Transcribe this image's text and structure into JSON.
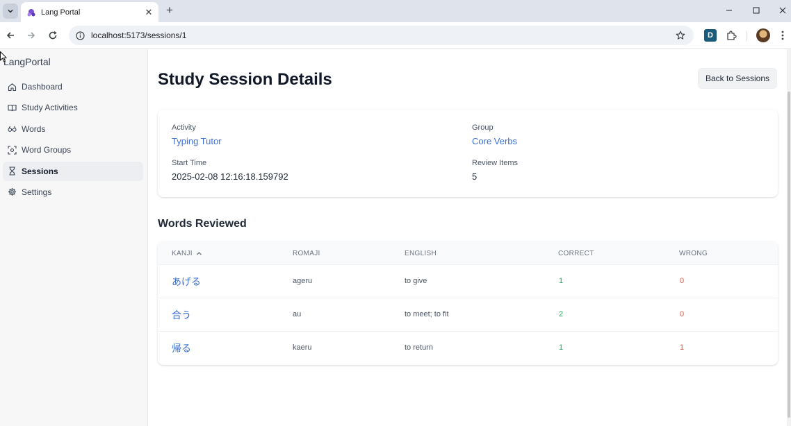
{
  "browser": {
    "tab_title": "Lang Portal",
    "url": "localhost:5173/sessions/1"
  },
  "sidebar": {
    "brand": "LangPortal",
    "items": [
      {
        "label": "Dashboard",
        "icon": "home-icon"
      },
      {
        "label": "Study Activities",
        "icon": "book-icon"
      },
      {
        "label": "Words",
        "icon": "words-icon"
      },
      {
        "label": "Word Groups",
        "icon": "scan-icon"
      },
      {
        "label": "Sessions",
        "icon": "hourglass-icon",
        "active": true
      },
      {
        "label": "Settings",
        "icon": "gear-icon"
      }
    ]
  },
  "page": {
    "title": "Study Session Details",
    "back_label": "Back to Sessions"
  },
  "details": {
    "activity_label": "Activity",
    "activity_value": "Typing Tutor",
    "group_label": "Group",
    "group_value": "Core Verbs",
    "start_label": "Start Time",
    "start_value": "2025-02-08 12:16:18.159792",
    "review_label": "Review Items",
    "review_value": "5"
  },
  "words_reviewed": {
    "title": "Words Reviewed",
    "columns": [
      "KANJI",
      "ROMAJI",
      "ENGLISH",
      "CORRECT",
      "WRONG"
    ],
    "rows": [
      {
        "kanji": "あげる",
        "romaji": "ageru",
        "english": "to give",
        "correct": "1",
        "wrong": "0"
      },
      {
        "kanji": "合う",
        "romaji": "au",
        "english": "to meet; to fit",
        "correct": "2",
        "wrong": "0"
      },
      {
        "kanji": "帰る",
        "romaji": "kaeru",
        "english": "to return",
        "correct": "1",
        "wrong": "1"
      }
    ]
  },
  "colors": {
    "link": "#3b6fd4",
    "correct": "#22a55a",
    "wrong": "#e0523a"
  }
}
